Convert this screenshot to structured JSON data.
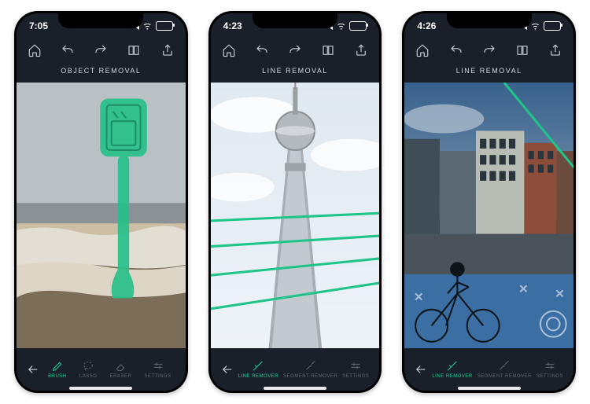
{
  "screens": [
    {
      "time": "7:05",
      "title": "OBJECT REMOVAL",
      "tools": [
        {
          "label": "BRUSH",
          "active": true
        },
        {
          "label": "LASSO",
          "active": false
        },
        {
          "label": "ERASER",
          "active": false
        },
        {
          "label": "SETTINGS",
          "active": false
        }
      ]
    },
    {
      "time": "4:23",
      "title": "LINE REMOVAL",
      "tools": [
        {
          "label": "LINE REMOVER",
          "active": true
        },
        {
          "label": "SEGMENT REMOVER",
          "active": false
        },
        {
          "label": "SETTINGS",
          "active": false
        }
      ]
    },
    {
      "time": "4:26",
      "title": "LINE REMOVAL",
      "tools": [
        {
          "label": "LINE REMOVER",
          "active": true
        },
        {
          "label": "SEGMENT REMOVER",
          "active": false
        },
        {
          "label": "SETTINGS",
          "active": false
        }
      ]
    }
  ]
}
